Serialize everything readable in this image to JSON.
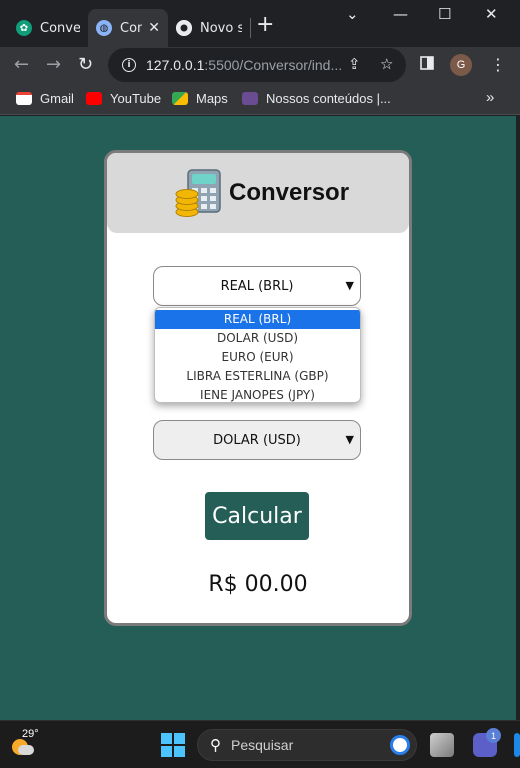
{
  "browser": {
    "tabs": [
      {
        "label": "Conver",
        "icon": "chatgpt-icon",
        "active": false
      },
      {
        "label": "Con",
        "icon": "globe-icon",
        "active": true
      },
      {
        "label": "Novo s",
        "icon": "chrome-icon",
        "active": false
      }
    ],
    "url_host": "127.0.0.1",
    "url_rest": ":5500/Conversor/ind...",
    "profile_initial": "G",
    "bookmarks": [
      "Gmail",
      "YouTube",
      "Maps",
      "Nossos conteúdos |..."
    ],
    "bookmarks_overflow": "»"
  },
  "app": {
    "title": "Conversor",
    "from_select": {
      "selected": "REAL (BRL)"
    },
    "dropdown_options": [
      "REAL (BRL)",
      "DOLAR (USD)",
      "EURO (EUR)",
      "LIBRA ESTERLINA (GBP)",
      "IENE JANOPES (JPY)"
    ],
    "dropdown_highlighted": "REAL (BRL)",
    "to_select": {
      "selected": "DOLAR (USD)"
    },
    "calculate_label": "Calcular",
    "result": "R$ 00.00",
    "colors": {
      "background": "#255e57",
      "button": "#255e57",
      "header": "#d9d9d9",
      "highlight": "#1a73e8"
    }
  },
  "taskbar": {
    "temperature": "29°",
    "search_placeholder": "Pesquisar",
    "notification_count": "1"
  }
}
